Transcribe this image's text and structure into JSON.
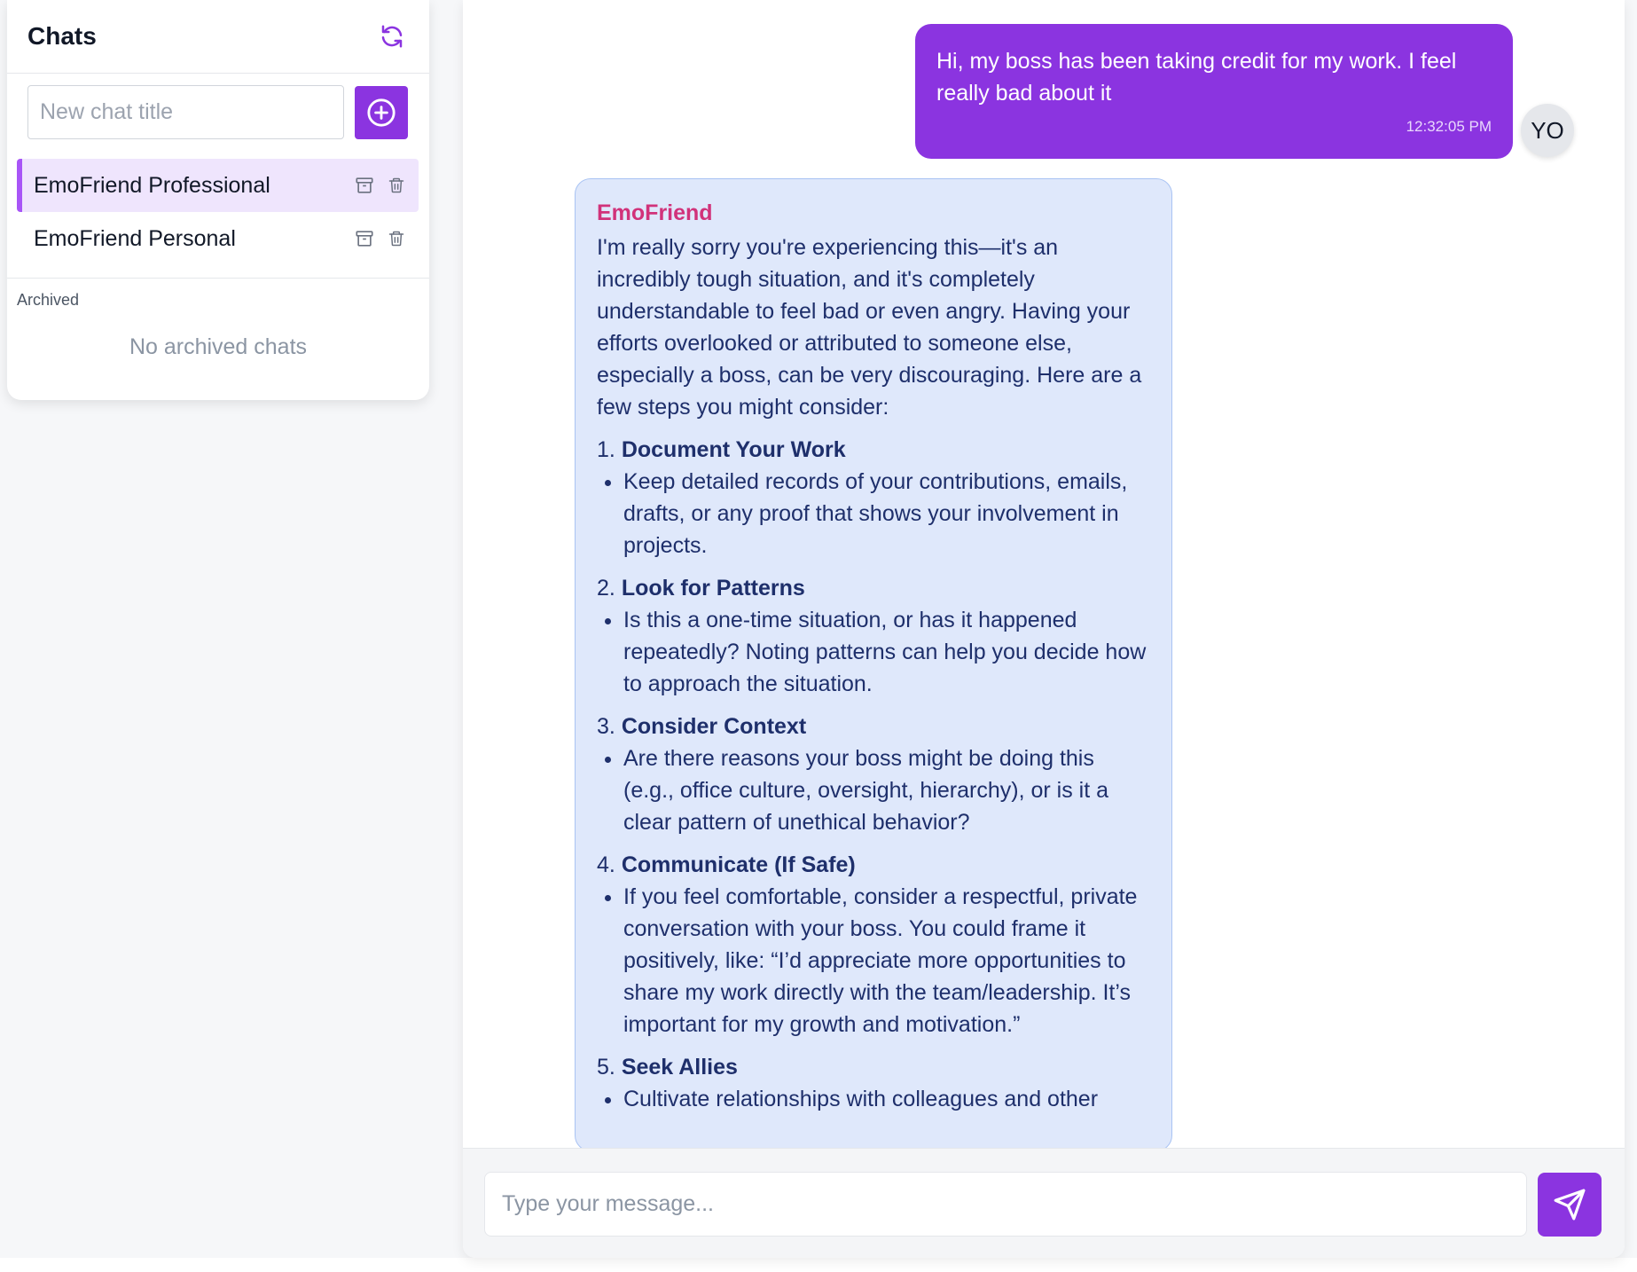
{
  "sidebar": {
    "title": "Chats",
    "new_chat_placeholder": "New chat title",
    "chats": [
      {
        "label": "EmoFriend Professional",
        "active": true
      },
      {
        "label": "EmoFriend Personal",
        "active": false
      }
    ],
    "archived_label": "Archived",
    "archived_empty": "No archived chats"
  },
  "conversation": {
    "user_message": {
      "text": "Hi, my boss has been taking credit for my work. I feel really bad about it",
      "time": "12:32:05 PM",
      "avatar": "YO"
    },
    "bot_message": {
      "sender": "EmoFriend",
      "intro": "I'm really sorry you're experiencing this—it's an incredibly tough situation, and it's completely understandable to feel bad or even angry. Having your efforts overlooked or attributed to someone else, especially a boss, can be very discouraging. Here are a few steps you might consider:",
      "steps": [
        {
          "num": "1.",
          "title": "Document Your Work",
          "bullet": "Keep detailed records of your contributions, emails, drafts, or any proof that shows your involvement in projects."
        },
        {
          "num": "2.",
          "title": "Look for Patterns",
          "bullet": "Is this a one-time situation, or has it happened repeatedly? Noting patterns can help you decide how to approach the situation."
        },
        {
          "num": "3.",
          "title": "Consider Context",
          "bullet": "Are there reasons your boss might be doing this (e.g., office culture, oversight, hierarchy), or is it a clear pattern of unethical behavior?"
        },
        {
          "num": "4.",
          "title": "Communicate (If Safe)",
          "bullet": "If you feel comfortable, consider a respectful, private conversation with your boss. You could frame it positively, like: “I’d appreciate more opportunities to share my work directly with the team/leadership. It’s important for my growth and motivation.”"
        },
        {
          "num": "5.",
          "title": "Seek Allies",
          "bullet": "Cultivate relationships with colleagues and other"
        }
      ]
    }
  },
  "composer": {
    "placeholder": "Type your message..."
  },
  "colors": {
    "accent": "#8b34e0",
    "bot_bubble": "#dfe8fb",
    "bot_name": "#d1327a"
  },
  "icons": [
    "refresh-icon",
    "plus-circle-icon",
    "archive-icon",
    "trash-icon",
    "send-icon"
  ]
}
